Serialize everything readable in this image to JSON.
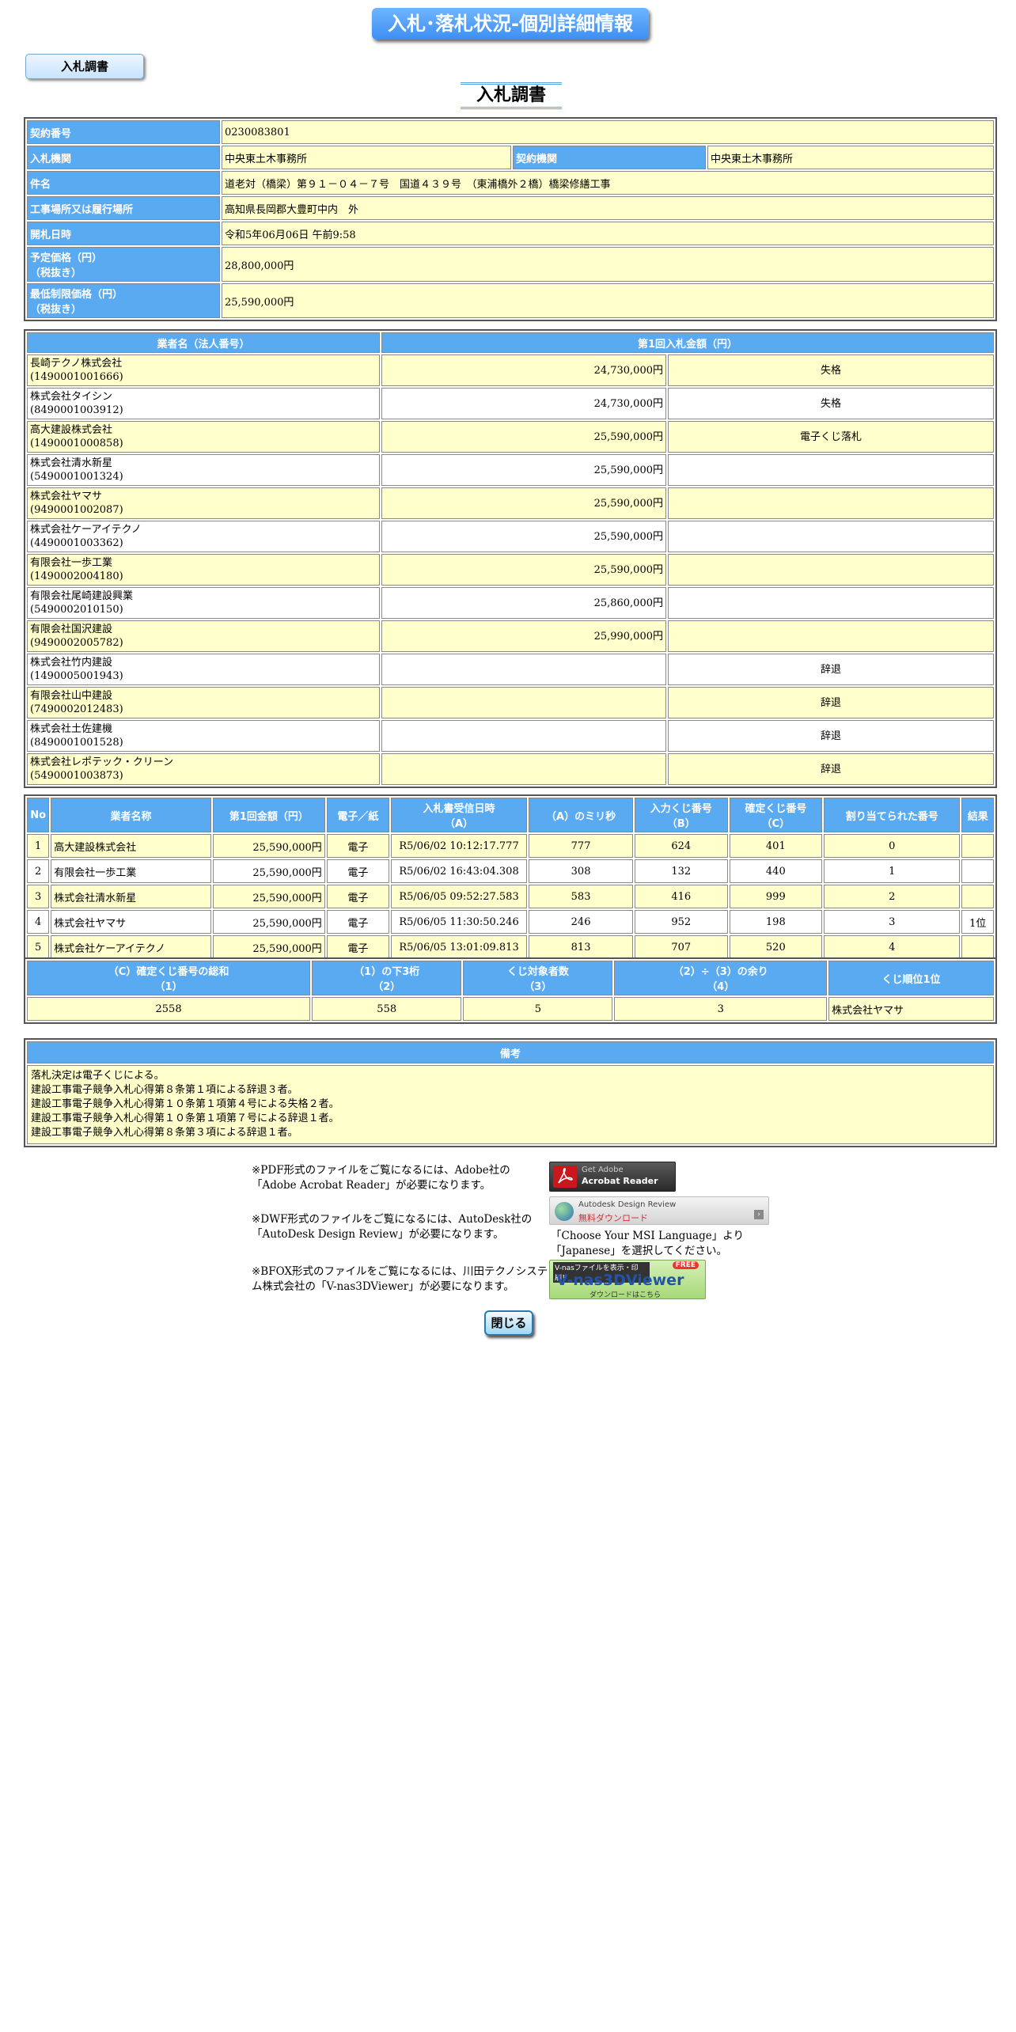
{
  "header": {
    "title": "入札･落札状況-個別詳細情報"
  },
  "tab": {
    "label": "入札調書"
  },
  "doc_title": "入札調書",
  "info": {
    "contract_no_label": "契約番号",
    "contract_no": "0230083801",
    "bid_org_label": "入札機関",
    "bid_org": "中央東土木事務所",
    "contract_org_label": "契約機関",
    "contract_org": "中央東土木事務所",
    "subject_label": "件名",
    "subject": "道老対（橋梁）第９１－０４－７号　国道４３９号　（東浦橋外２橋）橋梁修繕工事",
    "location_label": "工事場所又は履行場所",
    "location": "高知県長岡郡大豊町中内　外",
    "opening_label": "開札日時",
    "opening": "令和5年06月06日 午前9:58",
    "planned_price_label": "予定価格（円）\n（税抜き）",
    "planned_price": "28,800,000円",
    "min_price_label": "最低制限価格（円）\n（税抜き）",
    "min_price": "25,590,000円"
  },
  "bids": {
    "col_name": "業者名（法人番号）",
    "col_amount": "第1回入札金額（円）",
    "rows": [
      {
        "name": "長崎テクノ株式会社",
        "id": "(1490001001666)",
        "amount": "24,730,000円",
        "note": "失格"
      },
      {
        "name": "株式会社タイシン",
        "id": "(8490001003912)",
        "amount": "24,730,000円",
        "note": "失格"
      },
      {
        "name": "高大建設株式会社",
        "id": "(1490001000858)",
        "amount": "25,590,000円",
        "note": "電子くじ落札"
      },
      {
        "name": "株式会社清水新星",
        "id": "(5490001001324)",
        "amount": "25,590,000円",
        "note": ""
      },
      {
        "name": "株式会社ヤマサ",
        "id": "(9490001002087)",
        "amount": "25,590,000円",
        "note": ""
      },
      {
        "name": "株式会社ケーアイテクノ",
        "id": "(4490001003362)",
        "amount": "25,590,000円",
        "note": ""
      },
      {
        "name": "有限会社一歩工業",
        "id": "(1490002004180)",
        "amount": "25,590,000円",
        "note": ""
      },
      {
        "name": "有限会社尾崎建設興業",
        "id": "(5490002010150)",
        "amount": "25,860,000円",
        "note": ""
      },
      {
        "name": "有限会社国沢建設",
        "id": "(9490002005782)",
        "amount": "25,990,000円",
        "note": ""
      },
      {
        "name": "株式会社竹内建設",
        "id": "(1490005001943)",
        "amount": "",
        "note": "辞退"
      },
      {
        "name": "有限会社山中建設",
        "id": "(7490002012483)",
        "amount": "",
        "note": "辞退"
      },
      {
        "name": "株式会社土佐建機",
        "id": "(8490001001528)",
        "amount": "",
        "note": "辞退"
      },
      {
        "name": "株式会社レポテック・クリーン",
        "id": "(5490001003873)",
        "amount": "",
        "note": "辞退"
      }
    ]
  },
  "lottery": {
    "headers": [
      "No",
      "業者名称",
      "第1回金額（円）",
      "電子／紙",
      "入札書受信日時\n（A）",
      "（A）のミリ秒",
      "入力くじ番号\n（B）",
      "確定くじ番号\n（C）",
      "割り当てられた番号",
      "結果"
    ],
    "rows": [
      [
        "1",
        "高大建設株式会社",
        "25,590,000円",
        "電子",
        "R5/06/02 10:12:17.777",
        "777",
        "624",
        "401",
        "0",
        ""
      ],
      [
        "2",
        "有限会社一歩工業",
        "25,590,000円",
        "電子",
        "R5/06/02 16:43:04.308",
        "308",
        "132",
        "440",
        "1",
        ""
      ],
      [
        "3",
        "株式会社清水新星",
        "25,590,000円",
        "電子",
        "R5/06/05 09:52:27.583",
        "583",
        "416",
        "999",
        "2",
        ""
      ],
      [
        "4",
        "株式会社ヤマサ",
        "25,590,000円",
        "電子",
        "R5/06/05 11:30:50.246",
        "246",
        "952",
        "198",
        "3",
        "1位"
      ],
      [
        "5",
        "株式会社ケーアイテクノ",
        "25,590,000円",
        "電子",
        "R5/06/05 13:01:09.813",
        "813",
        "707",
        "520",
        "4",
        ""
      ]
    ]
  },
  "summary": {
    "headers": [
      "（C）確定くじ番号の総和\n（1）",
      "（1）の下3桁\n（2）",
      "くじ対象者数\n（3）",
      "（2）÷（3）の余り\n（4）",
      "くじ順位1位"
    ],
    "values": [
      "2558",
      "558",
      "5",
      "3",
      "株式会社ヤマサ"
    ]
  },
  "remarks": {
    "title": "備考",
    "lines": [
      "落札決定は電子くじによる。",
      "建設工事電子競争入札心得第８条第１項による辞退３者。",
      "建設工事電子競争入札心得第１０条第１項第４号による失格２者。",
      "建設工事電子競争入札心得第１０条第１項第７号による辞退１者。",
      "建設工事電子競争入札心得第８条第３項による辞退１者。"
    ]
  },
  "footer": {
    "pdf_note": "※PDF形式のファイルをご覧になるには、Adobe社の「Adobe Acrobat Reader」が必要になります。",
    "dwf_note": "※DWF形式のファイルをご覧になるには、AutoDesk社の「AutoDesk Design Review」が必要になります。",
    "bfox_note": "※BFOX形式のファイルをご覧になるには、川田テクノシステム株式会社の「V-nas3DViewer」が必要になります。",
    "adobe_badge_line1": "Get Adobe",
    "adobe_badge_line2": "Acrobat Reader",
    "autodesk_line1": "Autodesk Design Review",
    "autodesk_line2": "無料ダウンロード",
    "msi_note": "「Choose Your MSI Language」より「Japanese」を選択してください。",
    "vnas_top": "V-nasファイルを表示・印刷！",
    "vnas_free": "FREE",
    "vnas_main": "V-nas3DViewer",
    "vnas_sub": "ダウンロードはこちら"
  },
  "close_button": "閉じる"
}
